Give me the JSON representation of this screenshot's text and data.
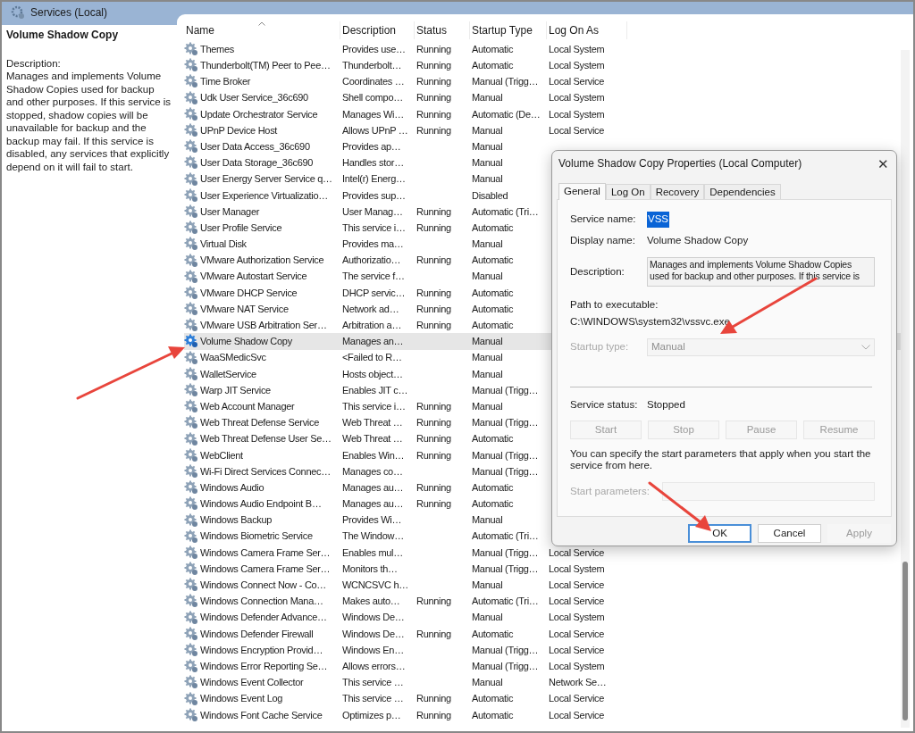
{
  "window": {
    "title": "Services (Local)"
  },
  "details": {
    "title": "Volume Shadow Copy",
    "description_label": "Description:",
    "description": "Manages and implements Volume Shadow Copies used for backup and other purposes. If this service is stopped, shadow copies will be unavailable for backup and the backup may fail. If this service is disabled, any services that explicitly depend on it will fail to start."
  },
  "table": {
    "columns": [
      {
        "label": "Name",
        "sorted": true
      },
      {
        "label": "Description",
        "sorted": false
      },
      {
        "label": "Status",
        "sorted": false
      },
      {
        "label": "Startup Type",
        "sorted": false
      },
      {
        "label": "Log On As",
        "sorted": false
      }
    ],
    "rows": [
      {
        "name": "Themes",
        "description": "Provides use…",
        "status": "Running",
        "startup": "Automatic",
        "logon": "Local System",
        "selected": false
      },
      {
        "name": "Thunderbolt(TM) Peer to Pee…",
        "description": "Thunderbolt…",
        "status": "Running",
        "startup": "Automatic",
        "logon": "Local System",
        "selected": false
      },
      {
        "name": "Time Broker",
        "description": "Coordinates …",
        "status": "Running",
        "startup": "Manual (Trigg…",
        "logon": "Local Service",
        "selected": false
      },
      {
        "name": "Udk User Service_36c690",
        "description": "Shell compo…",
        "status": "Running",
        "startup": "Manual",
        "logon": "Local System",
        "selected": false
      },
      {
        "name": "Update Orchestrator Service",
        "description": "Manages Wi…",
        "status": "Running",
        "startup": "Automatic (De…",
        "logon": "Local System",
        "selected": false
      },
      {
        "name": "UPnP Device Host",
        "description": "Allows UPnP …",
        "status": "Running",
        "startup": "Manual",
        "logon": "Local Service",
        "selected": false
      },
      {
        "name": "User Data Access_36c690",
        "description": "Provides ap…",
        "startup": "Manual",
        "selected": false
      },
      {
        "name": "User Data Storage_36c690",
        "description": "Handles stor…",
        "startup": "Manual",
        "selected": false
      },
      {
        "name": "User Energy Server Service q…",
        "description": "Intel(r) Energ…",
        "startup": "Manual",
        "selected": false
      },
      {
        "name": "User Experience Virtualizatio…",
        "description": "Provides sup…",
        "startup": "Disabled",
        "selected": false
      },
      {
        "name": "User Manager",
        "description": "User Manag…",
        "status": "Running",
        "startup": "Automatic (Tri…",
        "selected": false
      },
      {
        "name": "User Profile Service",
        "description": "This service i…",
        "status": "Running",
        "startup": "Automatic",
        "selected": false
      },
      {
        "name": "Virtual Disk",
        "description": "Provides ma…",
        "startup": "Manual",
        "selected": false
      },
      {
        "name": "VMware Authorization Service",
        "description": "Authorizatio…",
        "status": "Running",
        "startup": "Automatic",
        "selected": false
      },
      {
        "name": "VMware Autostart Service",
        "description": "The service f…",
        "startup": "Manual",
        "selected": false
      },
      {
        "name": "VMware DHCP Service",
        "description": "DHCP servic…",
        "status": "Running",
        "startup": "Automatic",
        "selected": false
      },
      {
        "name": "VMware NAT Service",
        "description": "Network ad…",
        "status": "Running",
        "startup": "Automatic",
        "selected": false
      },
      {
        "name": "VMware USB Arbitration Ser…",
        "description": "Arbitration a…",
        "status": "Running",
        "startup": "Automatic",
        "selected": false
      },
      {
        "name": "Volume Shadow Copy",
        "description": "Manages an…",
        "startup": "Manual",
        "selected": true
      },
      {
        "name": "WaaSMedicSvc",
        "description": "<Failed to R…",
        "startup": "Manual",
        "selected": false
      },
      {
        "name": "WalletService",
        "description": "Hosts object…",
        "startup": "Manual",
        "selected": false
      },
      {
        "name": "Warp JIT Service",
        "description": "Enables JIT c…",
        "startup": "Manual (Trigg…",
        "selected": false
      },
      {
        "name": "Web Account Manager",
        "description": "This service i…",
        "status": "Running",
        "startup": "Manual",
        "selected": false
      },
      {
        "name": "Web Threat Defense Service",
        "description": "Web Threat …",
        "status": "Running",
        "startup": "Manual (Trigg…",
        "selected": false
      },
      {
        "name": "Web Threat Defense User Se…",
        "description": "Web Threat …",
        "status": "Running",
        "startup": "Automatic",
        "selected": false
      },
      {
        "name": "WebClient",
        "description": "Enables Win…",
        "status": "Running",
        "startup": "Manual (Trigg…",
        "selected": false
      },
      {
        "name": "Wi-Fi Direct Services Connec…",
        "description": "Manages co…",
        "startup": "Manual (Trigg…",
        "selected": false
      },
      {
        "name": "Windows Audio",
        "description": "Manages au…",
        "status": "Running",
        "startup": "Automatic",
        "selected": false
      },
      {
        "name": "Windows Audio Endpoint B…",
        "description": "Manages au…",
        "status": "Running",
        "startup": "Automatic",
        "selected": false
      },
      {
        "name": "Windows Backup",
        "description": "Provides Wi…",
        "startup": "Manual",
        "selected": false
      },
      {
        "name": "Windows Biometric Service",
        "description": "The Window…",
        "startup": "Automatic (Tri…",
        "selected": false
      },
      {
        "name": "Windows Camera Frame Ser…",
        "description": "Enables mul…",
        "startup": "Manual (Trigg…",
        "logon": "Local Service",
        "selected": false
      },
      {
        "name": "Windows Camera Frame Ser…",
        "description": "Monitors th…",
        "startup": "Manual (Trigg…",
        "logon": "Local System",
        "selected": false
      },
      {
        "name": "Windows Connect Now - Co…",
        "description": "WCNCSVC h…",
        "startup": "Manual",
        "logon": "Local Service",
        "selected": false
      },
      {
        "name": "Windows Connection Mana…",
        "description": "Makes auto…",
        "status": "Running",
        "startup": "Automatic (Tri…",
        "logon": "Local Service",
        "selected": false
      },
      {
        "name": "Windows Defender Advance…",
        "description": "Windows De…",
        "startup": "Manual",
        "logon": "Local System",
        "selected": false
      },
      {
        "name": "Windows Defender Firewall",
        "description": "Windows De…",
        "status": "Running",
        "startup": "Automatic",
        "logon": "Local Service",
        "selected": false
      },
      {
        "name": "Windows Encryption Provid…",
        "description": "Windows En…",
        "startup": "Manual (Trigg…",
        "logon": "Local Service",
        "selected": false
      },
      {
        "name": "Windows Error Reporting Se…",
        "description": "Allows errors…",
        "startup": "Manual (Trigg…",
        "logon": "Local System",
        "selected": false
      },
      {
        "name": "Windows Event Collector",
        "description": "This service …",
        "startup": "Manual",
        "logon": "Network Se…",
        "selected": false
      },
      {
        "name": "Windows Event Log",
        "description": "This service …",
        "status": "Running",
        "startup": "Automatic",
        "logon": "Local Service",
        "selected": false
      },
      {
        "name": "Windows Font Cache Service",
        "description": "Optimizes p…",
        "status": "Running",
        "startup": "Automatic",
        "logon": "Local Service",
        "selected": false
      }
    ]
  },
  "dialog": {
    "title": "Volume Shadow Copy Properties (Local Computer)",
    "close": "✕",
    "tabs": [
      {
        "label": "General",
        "selected": true
      },
      {
        "label": "Log On",
        "selected": false
      },
      {
        "label": "Recovery",
        "selected": false
      },
      {
        "label": "Dependencies",
        "selected": false
      }
    ],
    "service_name": {
      "label": "Service name:",
      "value": "VSS",
      "selected": true
    },
    "display_name": {
      "label": "Display name:",
      "value": "Volume Shadow Copy"
    },
    "description": {
      "label": "Description:",
      "value": "Manages and implements Volume Shadow Copies used for backup and other purposes. If this service is"
    },
    "path": {
      "label": "Path to executable:",
      "value": "C:\\WINDOWS\\system32\\vssvc.exe"
    },
    "startup_type": {
      "label": "Startup type:",
      "value": "Manual",
      "disabled": true
    },
    "service_status": {
      "label": "Service status:",
      "value": "Stopped"
    },
    "control_buttons": [
      {
        "label": "Start",
        "disabled": true
      },
      {
        "label": "Stop",
        "disabled": true
      },
      {
        "label": "Pause",
        "disabled": true
      },
      {
        "label": "Resume",
        "disabled": true
      }
    ],
    "hint": "You can specify the start parameters that apply when you start the service from here.",
    "start_parameters": {
      "label": "Start parameters:",
      "disabled": true
    },
    "buttons": [
      {
        "label": "OK",
        "default": true,
        "disabled": false
      },
      {
        "label": "Cancel",
        "default": false,
        "disabled": false
      },
      {
        "label": "Apply",
        "default": false,
        "disabled": true
      }
    ]
  }
}
